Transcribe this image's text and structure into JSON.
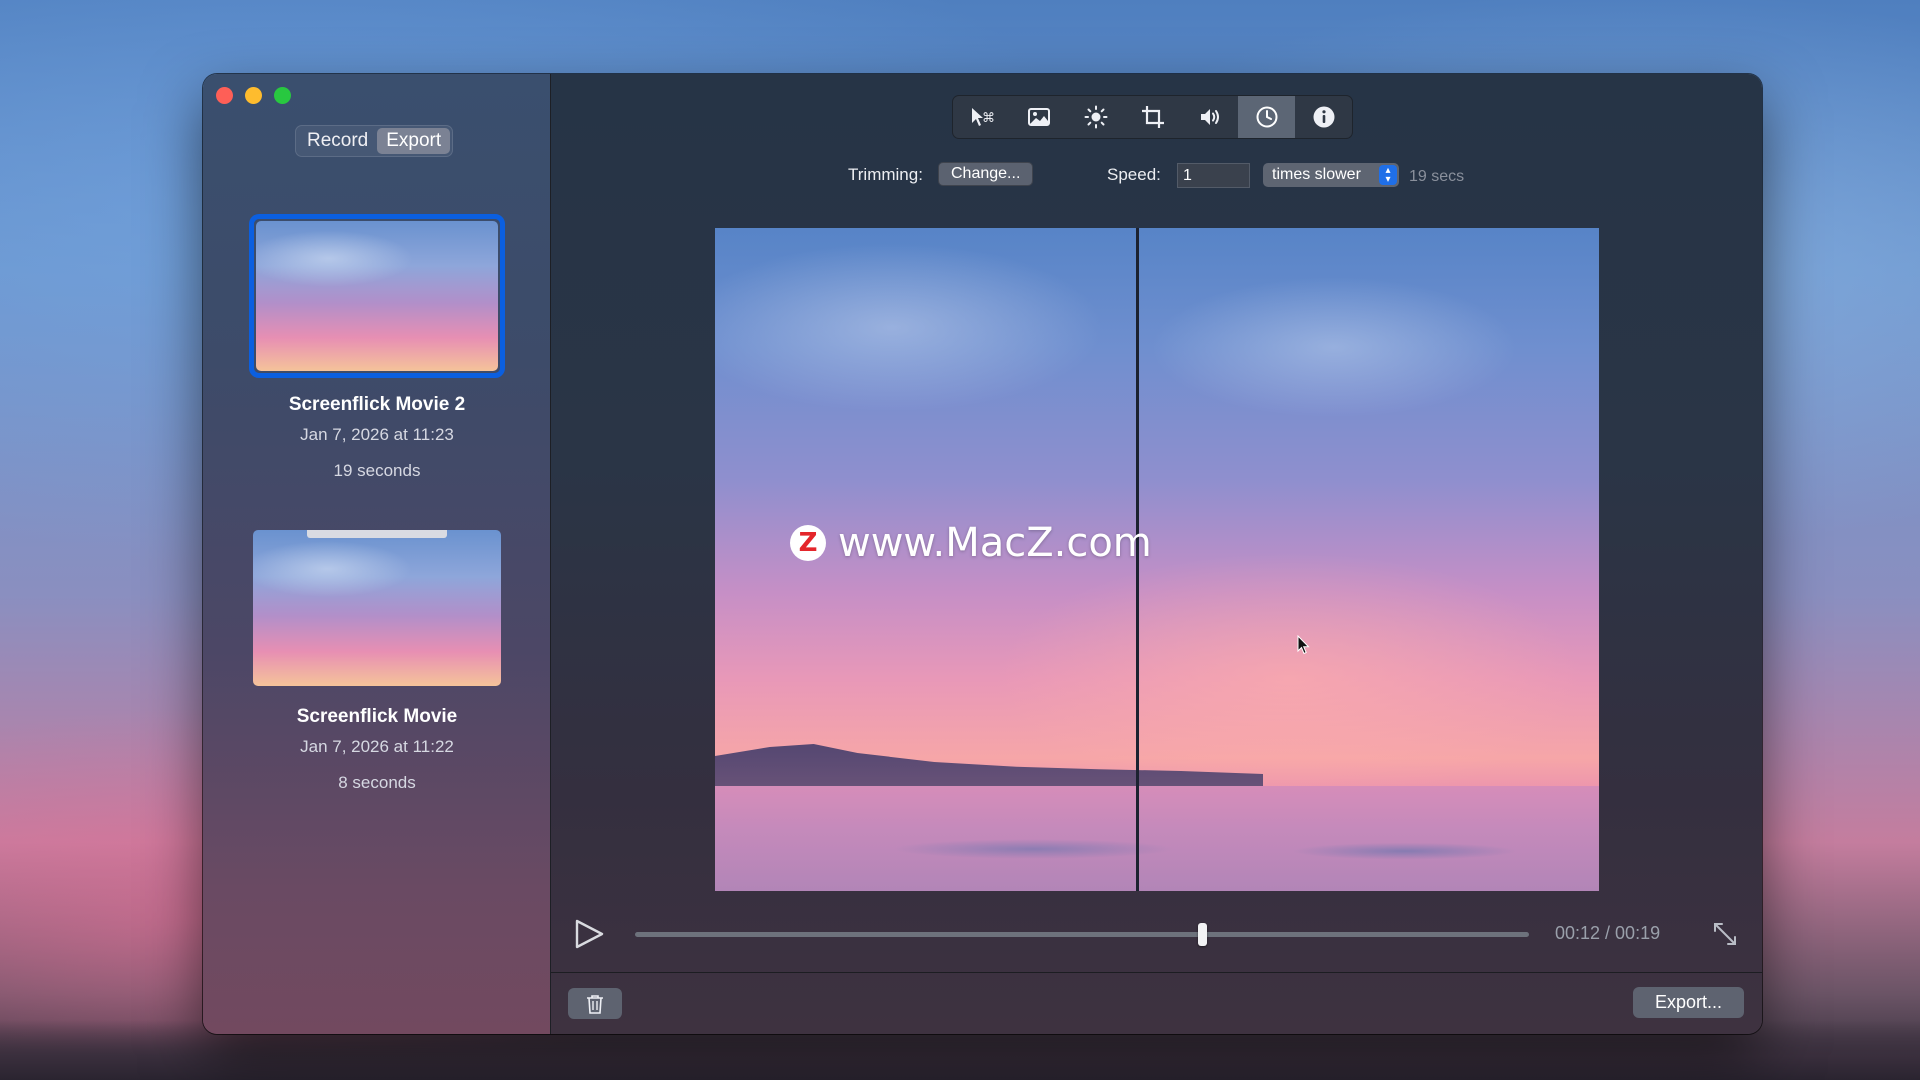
{
  "sidebar": {
    "segments": [
      {
        "label": "Record",
        "active": false
      },
      {
        "label": "Export",
        "active": true
      }
    ],
    "movies": [
      {
        "title": "Screenflick Movie 2",
        "date": "Jan 7, 2026 at 11:23",
        "duration": "19 seconds",
        "selected": true
      },
      {
        "title": "Screenflick Movie",
        "date": "Jan 7, 2026 at 11:22",
        "duration": "8 seconds",
        "selected": false
      }
    ]
  },
  "toolbar": {
    "tools": [
      {
        "name": "keyboard-clicks-icon",
        "active": false
      },
      {
        "name": "image-icon",
        "active": false
      },
      {
        "name": "brightness-icon",
        "active": false
      },
      {
        "name": "crop-icon",
        "active": false
      },
      {
        "name": "volume-icon",
        "active": false
      },
      {
        "name": "clock-icon",
        "active": true
      },
      {
        "name": "info-icon",
        "active": false
      }
    ]
  },
  "options": {
    "trimming_label": "Trimming:",
    "change_label": "Change...",
    "speed_label": "Speed:",
    "speed_value": "1",
    "speed_mode": "times slower",
    "result_duration": "19 secs"
  },
  "preview": {
    "watermark_logo": "Z",
    "watermark_text": "www.MacZ.com"
  },
  "playback": {
    "current": "00:12",
    "total": "00:19",
    "timecode": "00:12 / 00:19",
    "progress": 0.634
  },
  "bottom": {
    "export_label": "Export..."
  },
  "colors": {
    "accent": "#0b5fe0",
    "select_chevron": "#1f6fe8"
  }
}
